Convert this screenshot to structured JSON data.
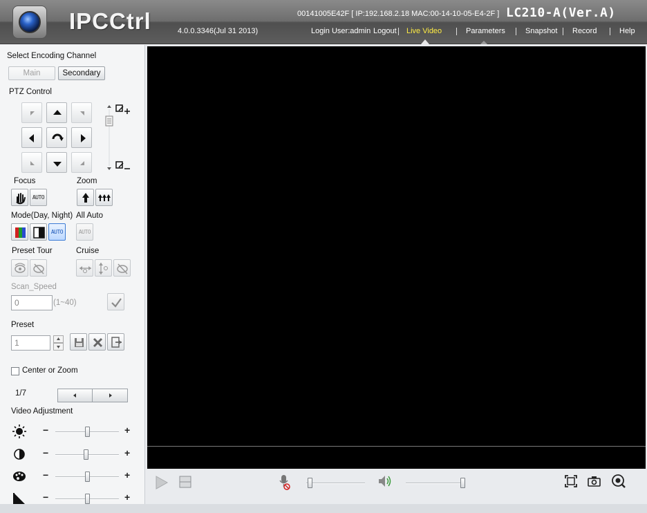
{
  "header": {
    "app_name": "IPCCtrl",
    "version": "4.0.0.3346(Jul 31 2013)",
    "device_info": "00141005E42F [ IP:192.168.2.18  MAC:00-14-10-05-E4-2F ]",
    "model": "LC210-A(Ver.A)",
    "login_user": "Login User:admin",
    "nav": {
      "logout": "Logout",
      "live_video": "Live Video",
      "parameters": "Parameters",
      "snapshot": "Snapshot",
      "record": "Record",
      "help": "Help"
    },
    "active_nav": "Live Video"
  },
  "left": {
    "encoding_title": "Select Encoding Channel",
    "channel_main": "Main",
    "channel_secondary": "Secondary",
    "ptz_title": "PTZ Control",
    "focus_label": "Focus",
    "zoom_label": "Zoom",
    "auto_text": "AUTO",
    "mode_label": "Mode(Day, Night)",
    "all_auto_label": "All Auto",
    "preset_tour_label": "Preset Tour",
    "cruise_label": "Cruise",
    "scan_speed_label": "Scan_Speed",
    "scan_speed_value": "0",
    "scan_speed_range": "(1~40)",
    "preset_label": "Preset",
    "preset_value": "1",
    "center_zoom_label": "Center or Zoom",
    "page_indicator": "1/7",
    "video_adjust_label": "Video Adjustment",
    "adjustments": [
      {
        "name": "brightness",
        "icon": "sun-icon",
        "value": 0.5
      },
      {
        "name": "contrast",
        "icon": "contrast-icon",
        "value": 0.48
      },
      {
        "name": "saturation",
        "icon": "palette-icon",
        "value": 0.5
      },
      {
        "name": "sharpness",
        "icon": "sharpness-icon",
        "value": 0.5
      }
    ],
    "minus": "−",
    "plus": "+"
  },
  "bottom": {
    "mic_volume": 0.02,
    "speaker_volume": 1.0
  },
  "colors": {
    "active_nav": "#ffec45",
    "video_bg": "#000000",
    "selected_mode": "#3a7bd5"
  }
}
